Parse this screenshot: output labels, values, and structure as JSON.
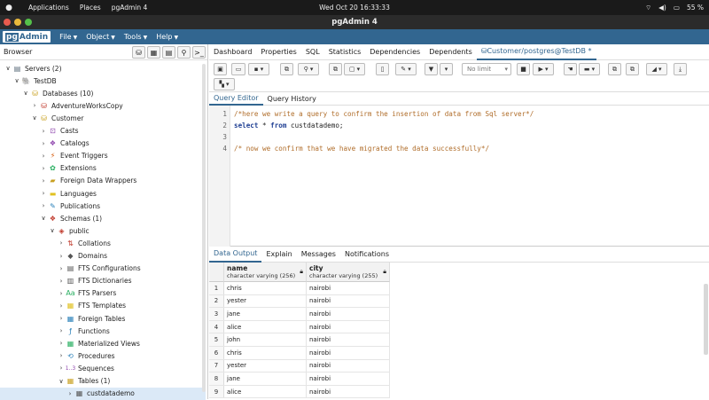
{
  "topbar": {
    "activities": "",
    "applications": "Applications",
    "places": "Places",
    "app_name": "pgAdmin 4",
    "clock": "Wed Oct 20  16:33:33",
    "battery": "55 %"
  },
  "window": {
    "title": "pgAdmin 4"
  },
  "menubar": {
    "logo_pg": "pg",
    "logo_admin": "Admin",
    "items": [
      "File",
      "Object",
      "Tools",
      "Help"
    ]
  },
  "browser": {
    "title": "Browser",
    "tree": [
      {
        "label": "Servers (2)",
        "arrow": "∨",
        "icon": "▤",
        "color": "#5a6b7a"
      },
      {
        "label": "TestDB",
        "arrow": "∨",
        "icon": "🐘",
        "color": "#336791"
      },
      {
        "label": "Databases (10)",
        "arrow": "∨",
        "icon": "⛁",
        "color": "#c8a020"
      },
      {
        "label": "AdventureWorksCopy",
        "arrow": "›",
        "icon": "⛁",
        "color": "#c0392b"
      },
      {
        "label": "Customer",
        "arrow": "∨",
        "icon": "⛁",
        "color": "#c8a020"
      },
      {
        "label": "Casts",
        "arrow": "›",
        "icon": "⊡",
        "color": "#8e44ad"
      },
      {
        "label": "Catalogs",
        "arrow": "›",
        "icon": "❖",
        "color": "#8e44ad"
      },
      {
        "label": "Event Triggers",
        "arrow": "›",
        "icon": "⚡",
        "color": "#d35400"
      },
      {
        "label": "Extensions",
        "arrow": "›",
        "icon": "✿",
        "color": "#27ae60"
      },
      {
        "label": "Foreign Data Wrappers",
        "arrow": "›",
        "icon": "▰",
        "color": "#c8a020"
      },
      {
        "label": "Languages",
        "arrow": "›",
        "icon": "▬",
        "color": "#e0c020"
      },
      {
        "label": "Publications",
        "arrow": "›",
        "icon": "✎",
        "color": "#2980b9"
      },
      {
        "label": "Schemas (1)",
        "arrow": "∨",
        "icon": "❖",
        "color": "#c0392b"
      },
      {
        "label": "public",
        "arrow": "∨",
        "icon": "◈",
        "color": "#c0392b"
      },
      {
        "label": "Collations",
        "arrow": "›",
        "icon": "⇅",
        "color": "#c0392b"
      },
      {
        "label": "Domains",
        "arrow": "›",
        "icon": "◆",
        "color": "#555"
      },
      {
        "label": "FTS Configurations",
        "arrow": "›",
        "icon": "▤",
        "color": "#555"
      },
      {
        "label": "FTS Dictionaries",
        "arrow": "›",
        "icon": "▥",
        "color": "#555"
      },
      {
        "label": "FTS Parsers",
        "arrow": "›",
        "icon": "Aa",
        "color": "#27ae60"
      },
      {
        "label": "FTS Templates",
        "arrow": "›",
        "icon": "▦",
        "color": "#e0c020"
      },
      {
        "label": "Foreign Tables",
        "arrow": "›",
        "icon": "▦",
        "color": "#2980b9"
      },
      {
        "label": "Functions",
        "arrow": "›",
        "icon": "ƒ",
        "color": "#2980b9"
      },
      {
        "label": "Materialized Views",
        "arrow": "›",
        "icon": "▦",
        "color": "#27ae60"
      },
      {
        "label": "Procedures",
        "arrow": "›",
        "icon": "⟲",
        "color": "#2980b9"
      },
      {
        "label": "Sequences",
        "arrow": "›",
        "icon": "1..3",
        "color": "#8e44ad"
      },
      {
        "label": "Tables (1)",
        "arrow": "∨",
        "icon": "▦",
        "color": "#c8a020"
      },
      {
        "label": "custdatademo",
        "arrow": "›",
        "icon": "▦",
        "color": "#555"
      }
    ]
  },
  "tabs": [
    "Dashboard",
    "Properties",
    "SQL",
    "Statistics",
    "Dependencies",
    "Dependents",
    "Customer/postgres@TestDB *"
  ],
  "toolbar": {
    "limit": "No limit"
  },
  "query_tabs": [
    "Query Editor",
    "Query History"
  ],
  "editor": {
    "lines": [
      {
        "n": "1",
        "text": "/*here we write a query to confirm the insertion of data from Sql server*/"
      },
      {
        "n": "2",
        "kw1": "select",
        "mid": " * ",
        "kw2": "from",
        "rest": " custdatademo;"
      },
      {
        "n": "3",
        "text": ""
      },
      {
        "n": "4",
        "text": "/* now we confirm that we have migrated the data successfully*/"
      }
    ]
  },
  "output_tabs": [
    "Data Output",
    "Explain",
    "Messages",
    "Notifications"
  ],
  "grid": {
    "columns": [
      {
        "name": "name",
        "type": "character varying (256)"
      },
      {
        "name": "city",
        "type": "character varying (255)"
      }
    ],
    "rows": [
      [
        "1",
        "chris",
        "nairobi"
      ],
      [
        "2",
        "yester",
        "nairobi"
      ],
      [
        "3",
        "jane",
        "nairobi"
      ],
      [
        "4",
        "alice",
        "nairobi"
      ],
      [
        "5",
        "john",
        "nairobi"
      ],
      [
        "6",
        "chris",
        "nairobi"
      ],
      [
        "7",
        "yester",
        "nairobi"
      ],
      [
        "8",
        "jane",
        "nairobi"
      ],
      [
        "9",
        "alice",
        "nairobi"
      ]
    ]
  }
}
